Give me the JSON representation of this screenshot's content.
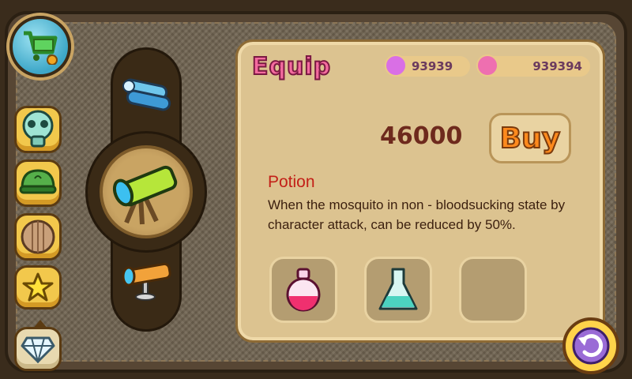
{
  "header": {
    "title": "Equip"
  },
  "currencies": [
    {
      "icon": "purple-gem-icon",
      "value": "93939",
      "color": "#d96fe5"
    },
    {
      "icon": "potion-coin-icon",
      "value": "939394",
      "color": "#ee6fb0"
    }
  ],
  "item": {
    "price": "46000",
    "buy_label": "Buy",
    "name": "Potion",
    "description": "When the mosquito in non - bloodsucking state by character attack, can be reduced by 50%."
  },
  "sidebar": {
    "items": [
      {
        "icon": "gas-mask-icon"
      },
      {
        "icon": "turtle-helmet-icon"
      },
      {
        "icon": "wooden-shield-icon"
      },
      {
        "icon": "star-icon"
      },
      {
        "icon": "diamond-icon"
      }
    ]
  },
  "telescopes": [
    {
      "icon": "blue-binoculars-icon"
    },
    {
      "icon": "green-telescope-icon",
      "selected": true
    },
    {
      "icon": "orange-telescope-icon"
    }
  ],
  "slots": [
    {
      "icon": "red-potion-icon"
    },
    {
      "icon": "teal-flask-icon"
    },
    {
      "icon": "empty-slot"
    }
  ],
  "colors": {
    "accent_pink": "#f46b9f",
    "buy_orange": "#ff8a1d",
    "name_red": "#c32018",
    "panel_bg": "#dcc390"
  }
}
